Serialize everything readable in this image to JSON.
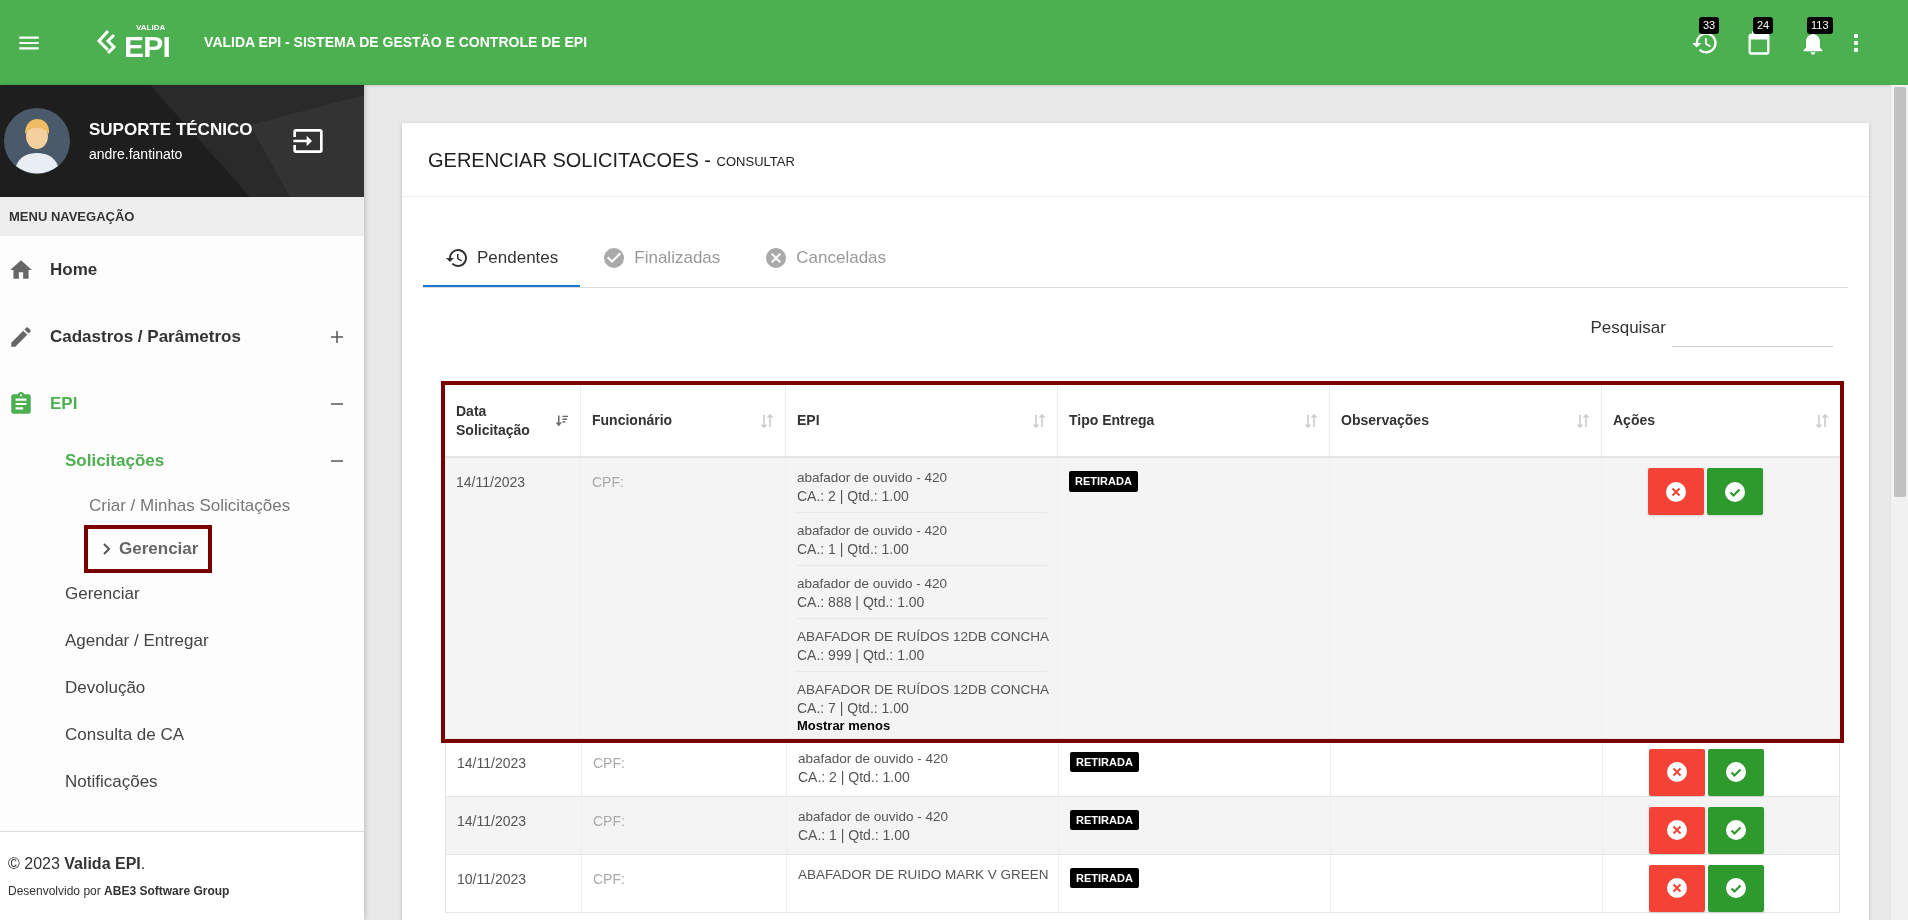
{
  "header": {
    "logo_small": "VALIDA",
    "logo_big": "EPI",
    "title": "VALIDA EPI - SISTEMA DE GESTÃO E CONTROLE DE EPI",
    "badges": [
      {
        "kind": "history",
        "count": "33"
      },
      {
        "kind": "calendar",
        "count": "24"
      },
      {
        "kind": "bell",
        "count": "113"
      }
    ]
  },
  "sidebar": {
    "user": {
      "name": "SUPORTE TÉCNICO",
      "login": "andre.fantinato"
    },
    "section_title": "MENU NAVEGAÇÃO",
    "items": [
      {
        "label": "Home",
        "active": false
      },
      {
        "label": "Cadastros / Parâmetros",
        "active": false,
        "expanded": false
      },
      {
        "label": "EPI",
        "active": true,
        "expanded": true,
        "children": [
          {
            "label": "Solicitações",
            "active": true,
            "expanded": true,
            "children": [
              {
                "label": "Criar / Minhas Solicitações",
                "selected": false,
                "highlighted": false
              },
              {
                "label": "Gerenciar",
                "selected": true,
                "highlighted": true
              }
            ]
          },
          {
            "label": "Gerenciar",
            "active": false
          },
          {
            "label": "Agendar / Entregar",
            "active": false
          },
          {
            "label": "Devolução",
            "active": false
          },
          {
            "label": "Consulta de CA",
            "active": false
          },
          {
            "label": "Notificações",
            "active": false
          }
        ]
      }
    ],
    "footer": [
      "© 2023 **Valida EPI**.",
      "Desenvolvido por **ABE3 Software Group**"
    ]
  },
  "page": {
    "title": "GERENCIAR SOLICITACOES - ",
    "subtitle": "CONSULTAR",
    "tabs": [
      {
        "label": "Pendentes",
        "selected": true
      },
      {
        "label": "Finalizadas",
        "selected": false
      },
      {
        "label": "Canceladas",
        "selected": false
      }
    ],
    "search": {
      "label": "Pesquisar"
    },
    "table": {
      "columns": [
        {
          "label": "Data Solicitação",
          "sorted": true
        },
        {
          "label": "Funcionário",
          "sorted": false
        },
        {
          "label": "EPI",
          "sorted": false
        },
        {
          "label": "Tipo Entrega",
          "sorted": false
        },
        {
          "label": "Observações",
          "sorted": false
        },
        {
          "label": "Ações",
          "sorted": false
        }
      ],
      "rows": [
        {
          "date": "14/11/2023",
          "employee": "CPF:",
          "highlighted": true,
          "items": [
            {
              "name": "abafador de ouvido - 420",
              "detail": "CA.: 2 | Qtd.: 1.00"
            },
            {
              "name": "abafador de ouvido - 420",
              "detail": "CA.: 1 | Qtd.: 1.00"
            },
            {
              "name": "abafador de ouvido - 420",
              "detail": "CA.: 888 | Qtd.: 1.00"
            },
            {
              "name": "ABAFADOR DE RUÍDOS 12DB CONCHA",
              "detail": "CA.: 999 | Qtd.: 1.00"
            },
            {
              "name": "ABAFADOR DE RUÍDOS 12DB CONCHA",
              "detail": "CA.: 7 | Qtd.: 1.00"
            }
          ],
          "toggle": "Mostrar menos",
          "delivery": "RETIRADA"
        },
        {
          "date": "14/11/2023",
          "employee": "CPF:",
          "highlighted": false,
          "items": [
            {
              "name": "abafador de ouvido - 420",
              "detail": "CA.: 2 | Qtd.: 1.00"
            }
          ],
          "delivery": "RETIRADA"
        },
        {
          "date": "14/11/2023",
          "employee": "CPF:",
          "highlighted": false,
          "items": [
            {
              "name": "abafador de ouvido - 420",
              "detail": "CA.: 1 | Qtd.: 1.00"
            }
          ],
          "delivery": "RETIRADA"
        },
        {
          "date": "10/11/2023",
          "employee": "CPF:",
          "highlighted": false,
          "items": [
            {
              "name": "ABAFADOR DE RUIDO MARK V GREEN"
            }
          ],
          "delivery": "RETIRADA"
        }
      ]
    }
  }
}
